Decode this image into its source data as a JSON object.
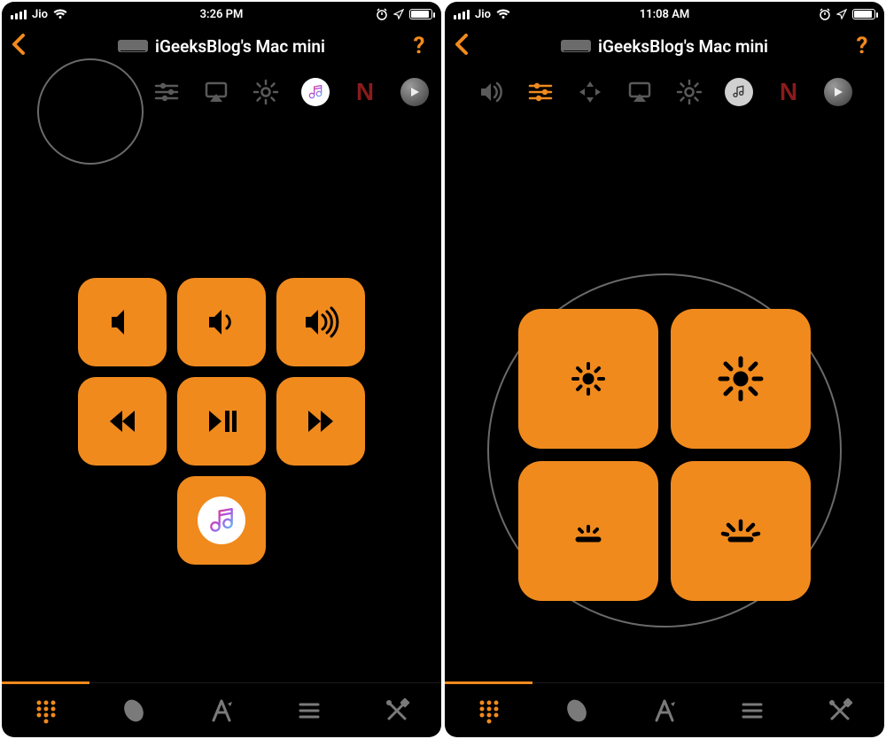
{
  "left": {
    "status": {
      "carrier": "Jio",
      "time": "3:26 PM"
    },
    "header": {
      "title": "iGeeksBlog's Mac mini",
      "help": "?"
    },
    "strip": {
      "items": [
        {
          "name": "sliders",
          "active": false
        },
        {
          "name": "airplay",
          "active": false
        },
        {
          "name": "gear",
          "active": false
        },
        {
          "name": "music",
          "active": false
        },
        {
          "name": "netflix",
          "active": false
        },
        {
          "name": "play",
          "active": false
        }
      ]
    },
    "pad": {
      "buttons": [
        {
          "name": "volume-mute"
        },
        {
          "name": "volume-low"
        },
        {
          "name": "volume-high"
        },
        {
          "name": "rewind"
        },
        {
          "name": "play-pause"
        },
        {
          "name": "forward"
        },
        {
          "name": "music-app"
        }
      ]
    }
  },
  "right": {
    "status": {
      "carrier": "Jio",
      "time": "11:08 AM"
    },
    "header": {
      "title": "iGeeksBlog's Mac mini",
      "help": "?"
    },
    "strip": {
      "items": [
        {
          "name": "volume",
          "active": false
        },
        {
          "name": "sliders",
          "active": true
        },
        {
          "name": "navigate",
          "active": false
        },
        {
          "name": "airplay",
          "active": false
        },
        {
          "name": "gear",
          "active": false
        },
        {
          "name": "music",
          "active": false
        },
        {
          "name": "netflix",
          "active": false
        },
        {
          "name": "play",
          "active": false
        }
      ]
    },
    "bright": {
      "buttons": [
        {
          "name": "brightness-down"
        },
        {
          "name": "brightness-up"
        },
        {
          "name": "keyboard-backlight-down"
        },
        {
          "name": "keyboard-backlight-up"
        }
      ]
    }
  },
  "tabs": [
    {
      "name": "keypad",
      "active": true
    },
    {
      "name": "mouse",
      "active": false
    },
    {
      "name": "apps",
      "active": false
    },
    {
      "name": "menu",
      "active": false
    },
    {
      "name": "tools",
      "active": false
    }
  ]
}
